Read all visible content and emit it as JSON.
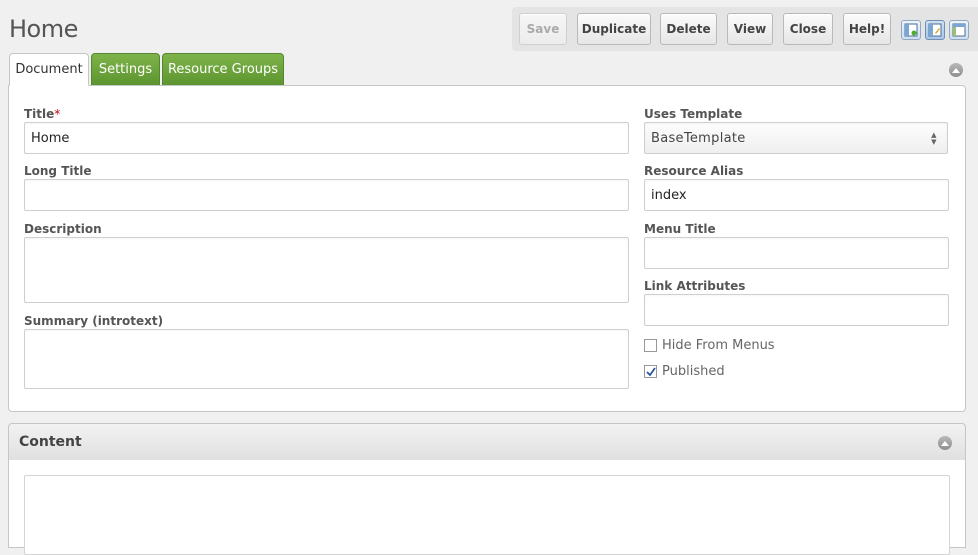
{
  "page": {
    "title": "Home"
  },
  "toolbar": {
    "save_label": "Save",
    "duplicate_label": "Duplicate",
    "delete_label": "Delete",
    "view_label": "View",
    "close_label": "Close",
    "help_label": "Help!",
    "layout_icons": [
      "layout-left-icon",
      "layout-center-icon",
      "layout-right-icon"
    ]
  },
  "tabs": [
    {
      "label": "Document"
    },
    {
      "label": "Settings"
    },
    {
      "label": "Resource Groups"
    }
  ],
  "form": {
    "title": {
      "label": "Title",
      "required_mark": "*",
      "value": "Home"
    },
    "long_title": {
      "label": "Long Title",
      "value": ""
    },
    "description": {
      "label": "Description",
      "value": ""
    },
    "summary": {
      "label": "Summary (introtext)",
      "value": ""
    },
    "template": {
      "label": "Uses Template",
      "value": "BaseTemplate"
    },
    "alias": {
      "label": "Resource Alias",
      "value": "index"
    },
    "menu_title": {
      "label": "Menu Title",
      "value": ""
    },
    "link_attributes": {
      "label": "Link Attributes",
      "value": ""
    },
    "hide_from_menus": {
      "label": "Hide From Menus",
      "checked": false
    },
    "published": {
      "label": "Published",
      "checked": true
    }
  },
  "content": {
    "title": "Content",
    "value": ""
  },
  "colors": {
    "tab_green": "#6aa33c",
    "panel_border": "#c6c6c6",
    "background": "#f0f0f0"
  }
}
